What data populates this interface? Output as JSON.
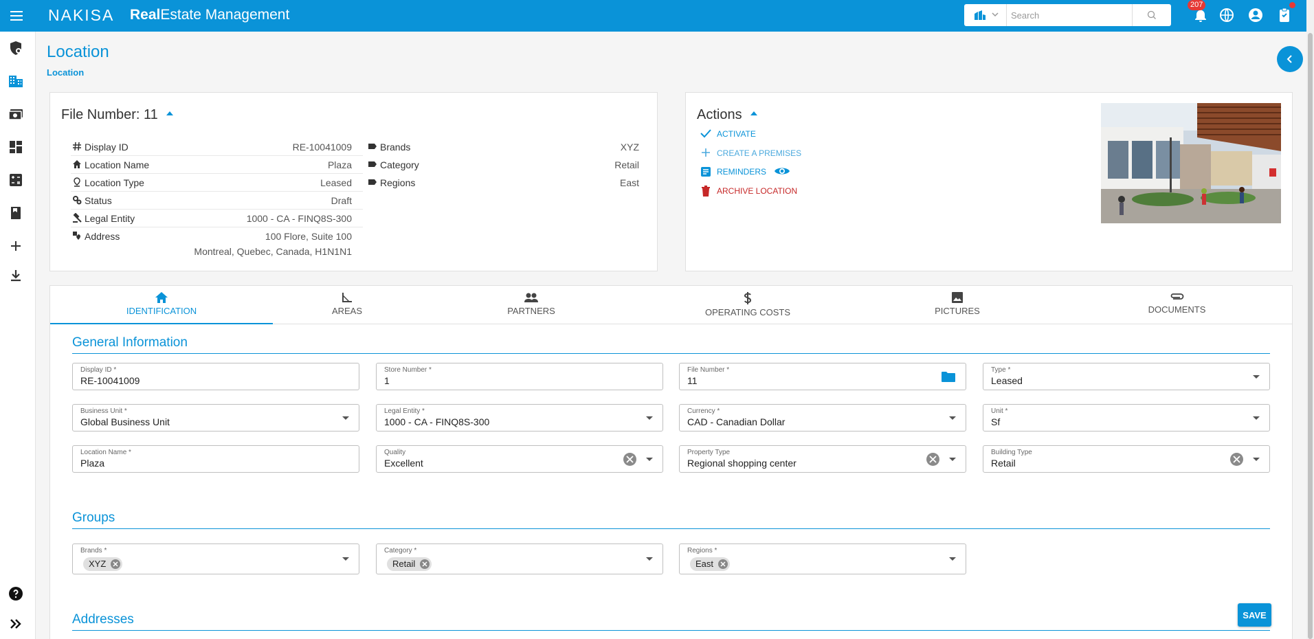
{
  "header": {
    "brand": "NAKISA",
    "title_bold": "Real",
    "title_rest": "Estate Management",
    "search_placeholder": "Search",
    "notification_count": "207"
  },
  "page": {
    "title": "Location",
    "breadcrumb": "Location"
  },
  "file_card": {
    "title": "File Number: 11",
    "left_rows": [
      {
        "label": "Display ID",
        "value": "RE-10041009",
        "icon": "hash-icon"
      },
      {
        "label": "Location Name",
        "value": "Plaza",
        "icon": "home-icon"
      },
      {
        "label": "Location Type",
        "value": "Leased",
        "icon": "pin-icon"
      },
      {
        "label": "Status",
        "value": "Draft",
        "icon": "gears-icon"
      },
      {
        "label": "Legal Entity",
        "value": "1000 - CA - FINQ8S-300",
        "icon": "gavel-icon"
      },
      {
        "label": "Address",
        "value": "100 Flore, Suite 100",
        "value2": "Montreal, Quebec, Canada, H1N1N1",
        "icon": "address-icon"
      }
    ],
    "right_rows": [
      {
        "label": "Brands",
        "value": "XYZ",
        "icon": "tag-icon"
      },
      {
        "label": "Category",
        "value": "Retail",
        "icon": "tag-icon"
      },
      {
        "label": "Regions",
        "value": "East",
        "icon": "tag-icon"
      }
    ]
  },
  "actions_card": {
    "title": "Actions",
    "items": [
      {
        "label": "ACTIVATE",
        "icon": "check-icon"
      },
      {
        "label": "CREATE A PREMISES",
        "icon": "plus-icon"
      },
      {
        "label": "REMINDERS",
        "icon": "reminder-icon"
      },
      {
        "label": "ARCHIVE LOCATION",
        "icon": "trash-icon"
      }
    ]
  },
  "tabs": [
    {
      "label": "IDENTIFICATION",
      "icon": "home-icon"
    },
    {
      "label": "AREAS",
      "icon": "ruler-icon"
    },
    {
      "label": "PARTNERS",
      "icon": "people-icon"
    },
    {
      "label": "OPERATING COSTS",
      "icon": "dollar-icon"
    },
    {
      "label": "PICTURES",
      "icon": "image-icon"
    },
    {
      "label": "DOCUMENTS",
      "icon": "paperclip-icon"
    }
  ],
  "general": {
    "title": "General Information",
    "fields": {
      "display_id": {
        "label": "Display ID *",
        "value": "RE-10041009"
      },
      "store_number": {
        "label": "Store Number *",
        "value": "1"
      },
      "file_number": {
        "label": "File Number *",
        "value": "11"
      },
      "type": {
        "label": "Type *",
        "value": "Leased"
      },
      "business_unit": {
        "label": "Business Unit *",
        "value": "Global Business Unit"
      },
      "legal_entity": {
        "label": "Legal Entity *",
        "value": "1000 - CA - FINQ8S-300"
      },
      "currency": {
        "label": "Currency *",
        "value": "CAD - Canadian Dollar"
      },
      "unit": {
        "label": "Unit *",
        "value": "Sf"
      },
      "location_name": {
        "label": "Location Name *",
        "value": "Plaza"
      },
      "quality": {
        "label": "Quality",
        "value": "Excellent"
      },
      "property_type": {
        "label": "Property Type",
        "value": "Regional shopping center"
      },
      "building_type": {
        "label": "Building Type",
        "value": "Retail"
      }
    }
  },
  "groups": {
    "title": "Groups",
    "brands": {
      "label": "Brands *",
      "chip": "XYZ"
    },
    "category": {
      "label": "Category *",
      "chip": "Retail"
    },
    "regions": {
      "label": "Regions *",
      "chip": "East"
    }
  },
  "addresses": {
    "title": "Addresses"
  },
  "save_label": "SAVE",
  "colors": {
    "primary": "#0a93d8",
    "danger": "#c62828",
    "badge": "#e53935"
  }
}
